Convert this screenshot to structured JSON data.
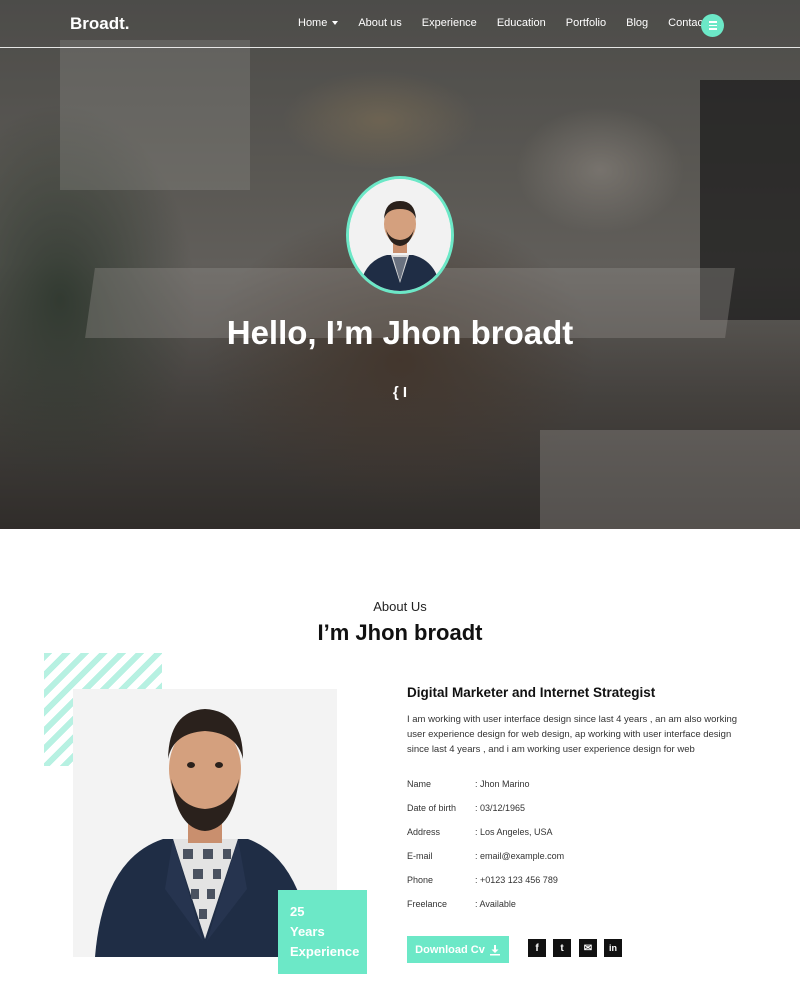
{
  "brand": {
    "logo": "Broadt.",
    "accent": "#6ce8c7"
  },
  "nav": {
    "items": [
      {
        "label": "Home",
        "has_dropdown": true
      },
      {
        "label": "About us"
      },
      {
        "label": "Experience"
      },
      {
        "label": "Education"
      },
      {
        "label": "Portfolio"
      },
      {
        "label": "Blog"
      },
      {
        "label": "Contact"
      }
    ],
    "menu_icon": "hamburger-icon"
  },
  "hero": {
    "title": "Hello, I’m Jhon broadt",
    "typed_text": "{ I"
  },
  "about": {
    "kicker": "About Us",
    "heading": "I’m Jhon broadt",
    "experience_badge": {
      "line1": "25",
      "line2": "Years",
      "line3": "Experience"
    },
    "role": "Digital Marketer and Internet Strategist",
    "bio": "I am working with user interface design since last 4 years , an am also working user experience design for web design, ap working with user interface design since last 4 years , and i am working user experience design for web",
    "info": [
      {
        "label": "Name",
        "value": ": Jhon Marino"
      },
      {
        "label": "Date of birth",
        "value": ": 03/12/1965"
      },
      {
        "label": "Address",
        "value": ": Los Angeles, USA"
      },
      {
        "label": "E-mail",
        "value": ": email@example.com"
      },
      {
        "label": "Phone",
        "value": ": +0123 123 456 789"
      },
      {
        "label": "Freelance",
        "value": ": Available"
      }
    ],
    "download_button": "Download Cv",
    "download_icon": "download-icon",
    "social": [
      {
        "icon": "facebook-icon",
        "glyph": "f"
      },
      {
        "icon": "twitter-icon",
        "glyph": "t"
      },
      {
        "icon": "mail-icon",
        "glyph": "✉"
      },
      {
        "icon": "linkedin-icon",
        "glyph": "in"
      }
    ]
  }
}
